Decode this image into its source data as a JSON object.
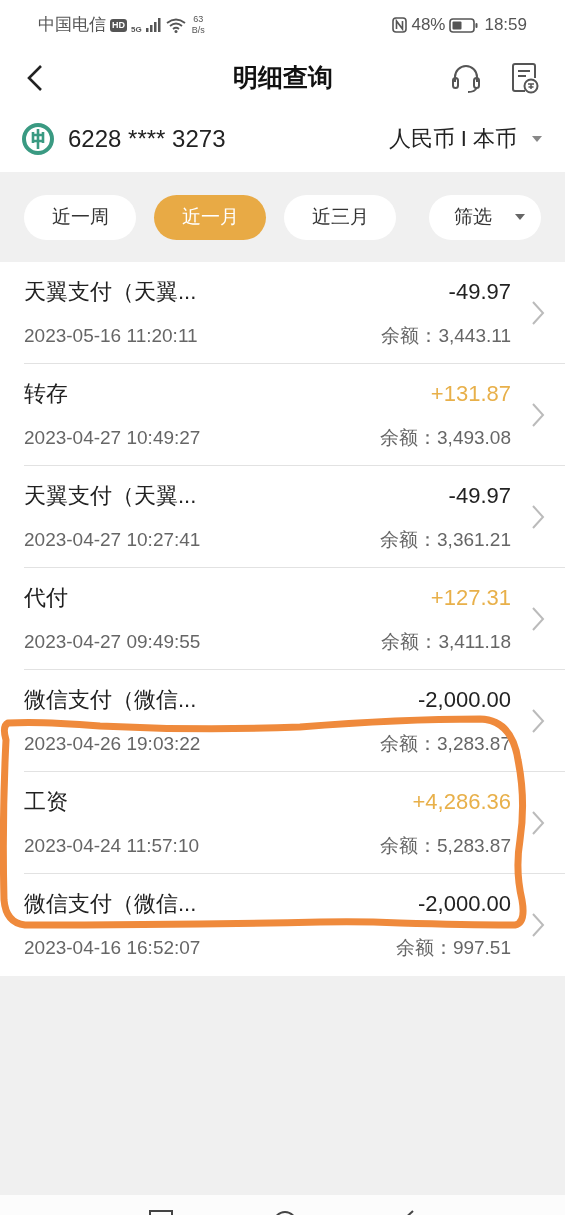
{
  "status_bar": {
    "carrier": "中国电信",
    "hd_badge": "HD",
    "network": "5G",
    "speed_value": "63",
    "speed_unit": "B/s",
    "battery_percent": "48%",
    "time": "18:59"
  },
  "header": {
    "title": "明细查询"
  },
  "account": {
    "card_number": "6228 **** 3273",
    "currency": "人民币 I 本币"
  },
  "filters": [
    {
      "label": "近一周",
      "selected": false
    },
    {
      "label": "近一月",
      "selected": true
    },
    {
      "label": "近三月",
      "selected": false
    }
  ],
  "filter_menu": {
    "label": "筛选"
  },
  "transactions": [
    {
      "title": "天翼支付（天翼...",
      "amount": "-49.97",
      "kind": "expense",
      "datetime": "2023-05-16 11:20:11",
      "balance": "余额：3,443.11"
    },
    {
      "title": "转存",
      "amount": "+131.87",
      "kind": "income",
      "datetime": "2023-04-27 10:49:27",
      "balance": "余额：3,493.08"
    },
    {
      "title": "天翼支付（天翼...",
      "amount": "-49.97",
      "kind": "expense",
      "datetime": "2023-04-27 10:27:41",
      "balance": "余额：3,361.21"
    },
    {
      "title": "代付",
      "amount": "+127.31",
      "kind": "income",
      "datetime": "2023-04-27 09:49:55",
      "balance": "余额：3,411.18"
    },
    {
      "title": "微信支付（微信...",
      "amount": "-2,000.00",
      "kind": "expense",
      "datetime": "2023-04-26 19:03:22",
      "balance": "余额：3,283.87"
    },
    {
      "title": "工资",
      "amount": "+4,286.36",
      "kind": "income",
      "datetime": "2023-04-24 11:57:10",
      "balance": "余额：5,283.87"
    },
    {
      "title": "微信支付（微信...",
      "amount": "-2,000.00",
      "kind": "expense",
      "datetime": "2023-04-16 16:52:07",
      "balance": "余额：997.51"
    }
  ]
}
